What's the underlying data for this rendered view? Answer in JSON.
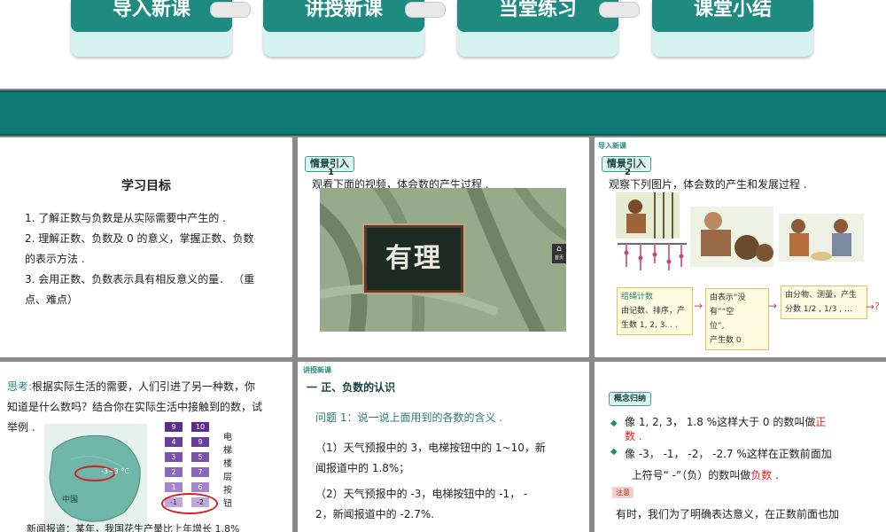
{
  "nav": {
    "items": [
      {
        "label": "导入新课"
      },
      {
        "label": "讲授新课"
      },
      {
        "label": "当堂练习"
      },
      {
        "label": "课堂小结"
      }
    ]
  },
  "slide1": {
    "title": "学习目标",
    "goals": [
      "1. 了解正数与负数是从实际需要中产生的 .",
      "2. 理解正数、负数及 0 的意义，掌握正数、负数",
      "的表示方法 .",
      "3. 会用正数、负数表示具有相反意义的量． （重",
      "点、难点）"
    ]
  },
  "slide2": {
    "tag": "情景引入",
    "num": "1",
    "text": "观看下面的视频，体会数的产生过程 .",
    "video_caption": "有理",
    "side_icon": "首页"
  },
  "slide3": {
    "header": "导入新课",
    "tag": "情景引入",
    "num": "2",
    "text": "观察下列图片，体会数的产生和发展过程 .",
    "flow": {
      "box1_title": "结绳计数",
      "box1_line1": "由记数、排序，产",
      "box1_line2": "生数 1, 2, 3. . .",
      "box2_line1": "由表示“没",
      "box2_line2": "有”“空",
      "box2_line3": "位”,",
      "box2_line4": "产生数 0",
      "box3_line1": "由分物、测量，产生",
      "box3_line2": "分数",
      "box3_fracs": "1/2 , 1/3 , …",
      "end": "?"
    }
  },
  "slide4": {
    "think_label": "思考:",
    "think_text": "根据实际生活的需要，人们引进了另一种数，你",
    "think_text2": "知道是什么数吗？结合你在实际生活中接触到的数，试",
    "think_text3": "举例 .",
    "map_label": "中国",
    "map_temp": "-3~3 °C",
    "elevator_label": [
      "电",
      "梯",
      "楼",
      "层",
      "按",
      "钮"
    ],
    "keys": [
      "9",
      "10",
      "4",
      "9",
      "3",
      "5",
      "2",
      "7",
      "1",
      "6",
      "-1",
      "-2"
    ],
    "news_text": "新闻报道：某年，我国花生产量比上年增长 1.8%"
  },
  "slide5": {
    "header": "讲授新课",
    "section": "一 正、负数的认识",
    "question": "问题 1：说一说上面用到的各数的含义 .",
    "item1a": "（1）天气预报中的 3，电梯按钮中的 1~10，新",
    "item1b": "闻报道中的 1.8%；",
    "item2a": "（2）天气预报中的 -3，电梯按钮中的 -1， -",
    "item2b": "2，新闻报道中的 -2.7%."
  },
  "slide6": {
    "tag": "概念归纳",
    "line1": "像 1, 2, 3， 1.8 %这样大于 0 的数叫做",
    "line1_key": "正",
    "line1_end": "数 .",
    "line2": "像 -3， -1， -2， -2.7 %这样在正数前面加",
    "line3": "上符号“ -”（负）的数叫做",
    "line3_key": "负数",
    "line3_end": ".",
    "note_tag": "注意",
    "note_text": "有时，我们为了明确表达意义，在正数前面也加"
  },
  "colors": {
    "brand": "#1e8a80",
    "band": "#0f7a73",
    "highlight": "#e02020"
  }
}
